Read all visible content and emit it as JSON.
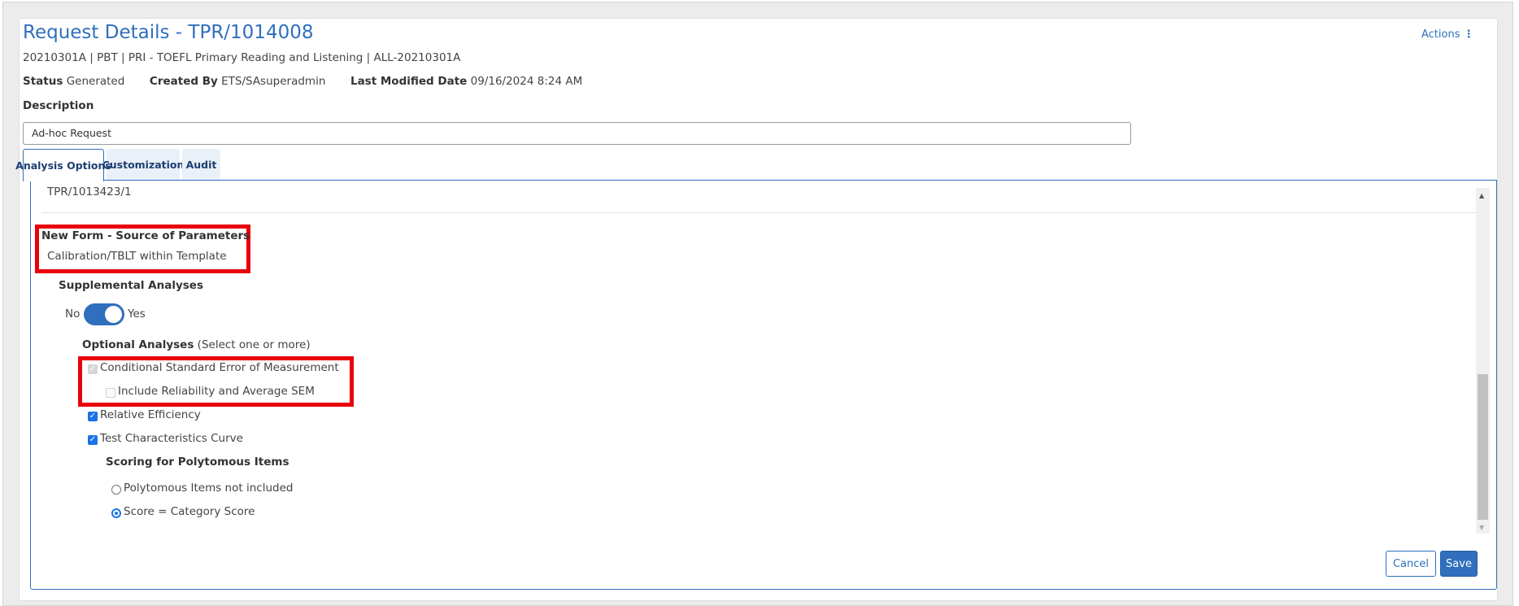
{
  "header": {
    "title": "Request Details - TPR/1014008",
    "subtitle": "20210301A | PBT | PRI - TOEFL Primary Reading and Listening | ALL-20210301A",
    "actions_label": "Actions",
    "actions_icon": "kebab-vertical-icon"
  },
  "meta": {
    "status_label": "Status",
    "status_value": "Generated",
    "created_by_label": "Created By",
    "created_by_value": "ETS/SAsuperadmin",
    "modified_label": "Last Modified Date",
    "modified_value": "09/16/2024 8:24 AM"
  },
  "description": {
    "label": "Description",
    "value": "Ad-hoc Request"
  },
  "tabs": [
    {
      "label": "Analysis Options",
      "active": true
    },
    {
      "label": "Customization",
      "active": false
    },
    {
      "label": "Audit",
      "active": false
    }
  ],
  "panel": {
    "reference": "TPR/1013423/1",
    "source_heading": "New Form - Source of Parameters",
    "source_value": "Calibration/TBLT within Template",
    "supplemental_heading": "Supplemental Analyses",
    "toggle": {
      "off_label": "No",
      "on_label": "Yes",
      "value": true
    },
    "optional_heading": "Optional Analyses",
    "optional_hint": "(Select one or more)",
    "options": [
      {
        "label": "Conditional Standard Error of Measurement",
        "checked": true,
        "disabled": true
      },
      {
        "label": "Include Reliability and Average SEM",
        "checked": false,
        "disabled": true
      },
      {
        "label": "Relative Efficiency",
        "checked": true,
        "disabled": false
      },
      {
        "label": "Test Characteristics Curve",
        "checked": true,
        "disabled": false
      }
    ],
    "scoring_heading": "Scoring for Polytomous Items",
    "scoring_options": [
      {
        "label": "Polytomous Items not included",
        "selected": false
      },
      {
        "label": "Score = Category Score",
        "selected": true
      }
    ]
  },
  "buttons": {
    "cancel": "Cancel",
    "save": "Save"
  },
  "colors": {
    "accent": "#2f6fbd",
    "highlight": "#e8000b",
    "checkbox": "#1a73e8"
  }
}
